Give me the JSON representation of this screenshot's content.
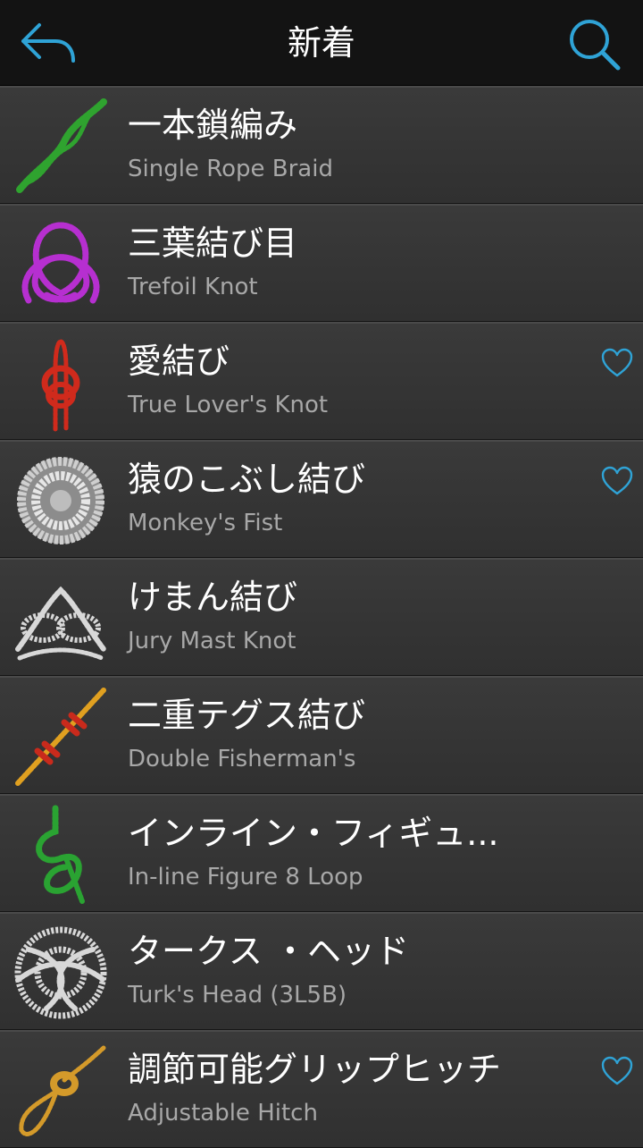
{
  "header": {
    "title": "新着",
    "back_icon": "back-arrow-icon",
    "search_icon": "search-icon",
    "accent_color": "#2fa3d6"
  },
  "knots": [
    {
      "jp": "一本鎖編み",
      "en": "Single Rope Braid",
      "favorite": false,
      "thumb": "braid",
      "color": "#2fa32f"
    },
    {
      "jp": "三葉結び目",
      "en": "Trefoil Knot",
      "favorite": false,
      "thumb": "trefoil",
      "color": "#b62fd0"
    },
    {
      "jp": "愛結び",
      "en": "True Lover's Knot",
      "favorite": true,
      "thumb": "lovers",
      "color": "#d02a1c"
    },
    {
      "jp": "猿のこぶし結び",
      "en": "Monkey's Fist",
      "favorite": true,
      "thumb": "fist",
      "color": "#cfcfcf"
    },
    {
      "jp": "けまん結び",
      "en": "Jury Mast Knot",
      "favorite": false,
      "thumb": "jury",
      "color": "#d8d8d8"
    },
    {
      "jp": "二重テグス結び",
      "en": "Double Fisherman's",
      "favorite": false,
      "thumb": "fisherman",
      "color": "#e0a020"
    },
    {
      "jp": "インライン・フィギュ...",
      "en": "In-line Figure 8 Loop",
      "favorite": false,
      "thumb": "figure8",
      "color": "#2aa332"
    },
    {
      "jp": "タークス ・ヘッド",
      "en": "Turk's Head (3L5B)",
      "favorite": false,
      "thumb": "turks",
      "color": "#d8d8d8"
    },
    {
      "jp": "調節可能グリップヒッチ",
      "en": "Adjustable Hitch",
      "favorite": true,
      "thumb": "hitch",
      "color": "#d49a2a"
    }
  ]
}
